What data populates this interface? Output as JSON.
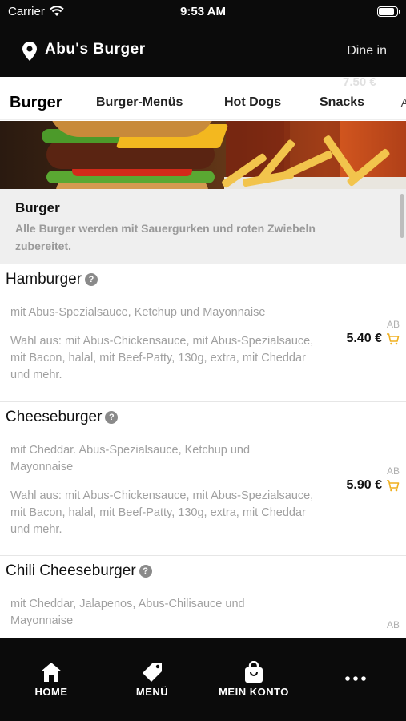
{
  "status_bar": {
    "carrier": "Carrier",
    "time": "9:53 AM",
    "battery_level": 0.95
  },
  "header": {
    "title": "Abu's Burger",
    "mode": "Dine in"
  },
  "ghost_price": "7.50 €",
  "tabs": [
    {
      "label": "Burger",
      "active": true
    },
    {
      "label": "Burger-Menüs",
      "active": false
    },
    {
      "label": "Hot Dogs",
      "active": false
    },
    {
      "label": "Snacks",
      "active": false
    }
  ],
  "category": {
    "title": "Burger",
    "description": "Alle Burger werden mit Sauergurken und roten Zwiebeln zubereitet."
  },
  "items": [
    {
      "name": "Hamburger",
      "description": "mit Abus-Spezialsauce, Ketchup und Mayonnaise",
      "options": "Wahl aus: mit Abus-Chickensauce, mit Abus-Spezialsauce, mit Bacon, halal, mit Beef-Patty, 130g, extra, mit Cheddar und mehr.",
      "price_prefix": "AB",
      "price": "5.40 €"
    },
    {
      "name": "Cheeseburger",
      "description": "mit Cheddar. Abus-Spezialsauce, Ketchup und Mayonnaise",
      "options": "Wahl aus: mit Abus-Chickensauce, mit Abus-Spezialsauce, mit Bacon, halal, mit Beef-Patty, 130g, extra, mit Cheddar und mehr.",
      "price_prefix": "AB",
      "price": "5.90 €"
    },
    {
      "name": "Chili Cheeseburger",
      "description": "mit Cheddar, Jalapenos, Abus-Chilisauce und Mayonnaise",
      "price_prefix": "AB"
    }
  ],
  "bottom_nav": [
    {
      "label": "HOME",
      "icon": "home-icon"
    },
    {
      "label": "MENÜ",
      "icon": "tag-icon"
    },
    {
      "label": "MEIN KONTO",
      "icon": "shopping-bag-icon"
    },
    {
      "label": "",
      "icon": "more-icon"
    }
  ],
  "colors": {
    "accent": "#f0b020",
    "bar": "#0b0b0b",
    "muted_text": "#a0a0a0"
  }
}
